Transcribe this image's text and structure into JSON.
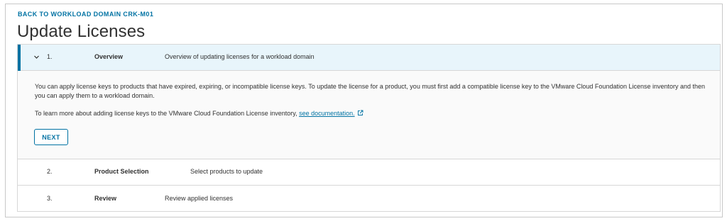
{
  "nav": {
    "back_label": "BACK TO WORKLOAD DOMAIN CRK-M01"
  },
  "page": {
    "title": "Update Licenses"
  },
  "steps": [
    {
      "number": "1.",
      "name": "Overview",
      "description": "Overview of updating licenses for a workload domain",
      "expanded": true
    },
    {
      "number": "2.",
      "name": "Product Selection",
      "description": "Select products to update",
      "expanded": false
    },
    {
      "number": "3.",
      "name": "Review",
      "description": "Review applied licenses",
      "expanded": false
    }
  ],
  "overview": {
    "paragraph_1": "You can apply license keys to products that have expired, expiring, or incompatible license keys. To update the license for a product, you must first add a compatible license key to the VMware Cloud Foundation License inventory and then you can apply them to a workload domain.",
    "paragraph_2_prefix": "To learn more about adding license keys to the VMware Cloud Foundation License inventory,",
    "doc_link": "see documentation.",
    "next_label": "NEXT"
  },
  "icons": {
    "expand": "chevron-down-icon",
    "external": "external-link-icon"
  },
  "colors": {
    "accent": "#0072a3",
    "active_step_bg": "#e8f5fb",
    "text": "#313131",
    "border": "#d7d7d7"
  }
}
